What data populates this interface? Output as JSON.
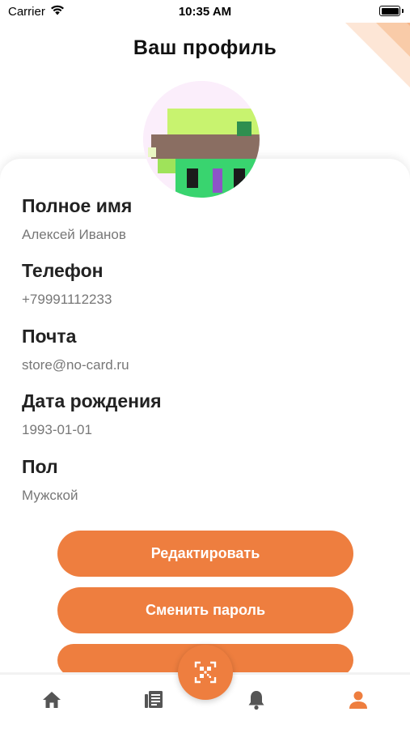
{
  "status_bar": {
    "carrier": "Carrier",
    "time": "10:35 AM"
  },
  "page": {
    "title": "Ваш профиль"
  },
  "profile": {
    "fields": [
      {
        "label": "Полное имя",
        "value": "Алексей Иванов"
      },
      {
        "label": "Телефон",
        "value": "+79991112233"
      },
      {
        "label": "Почта",
        "value": "store@no-card.ru"
      },
      {
        "label": "Дата рождения",
        "value": "1993-01-01"
      },
      {
        "label": "Пол",
        "value": "Мужской"
      }
    ]
  },
  "actions": {
    "edit_label": "Редактировать",
    "change_password_label": "Сменить пароль"
  },
  "tabbar": {
    "tabs": [
      {
        "icon": "home-icon",
        "active": false
      },
      {
        "icon": "news-icon",
        "active": false
      },
      {
        "icon": "qr-code-icon",
        "active": false
      },
      {
        "icon": "bell-icon",
        "active": false
      },
      {
        "icon": "profile-icon",
        "active": true
      }
    ]
  },
  "colors": {
    "accent": "#ee7e3f",
    "tab_inactive": "#555555",
    "label": "#222222",
    "value": "#777777"
  }
}
